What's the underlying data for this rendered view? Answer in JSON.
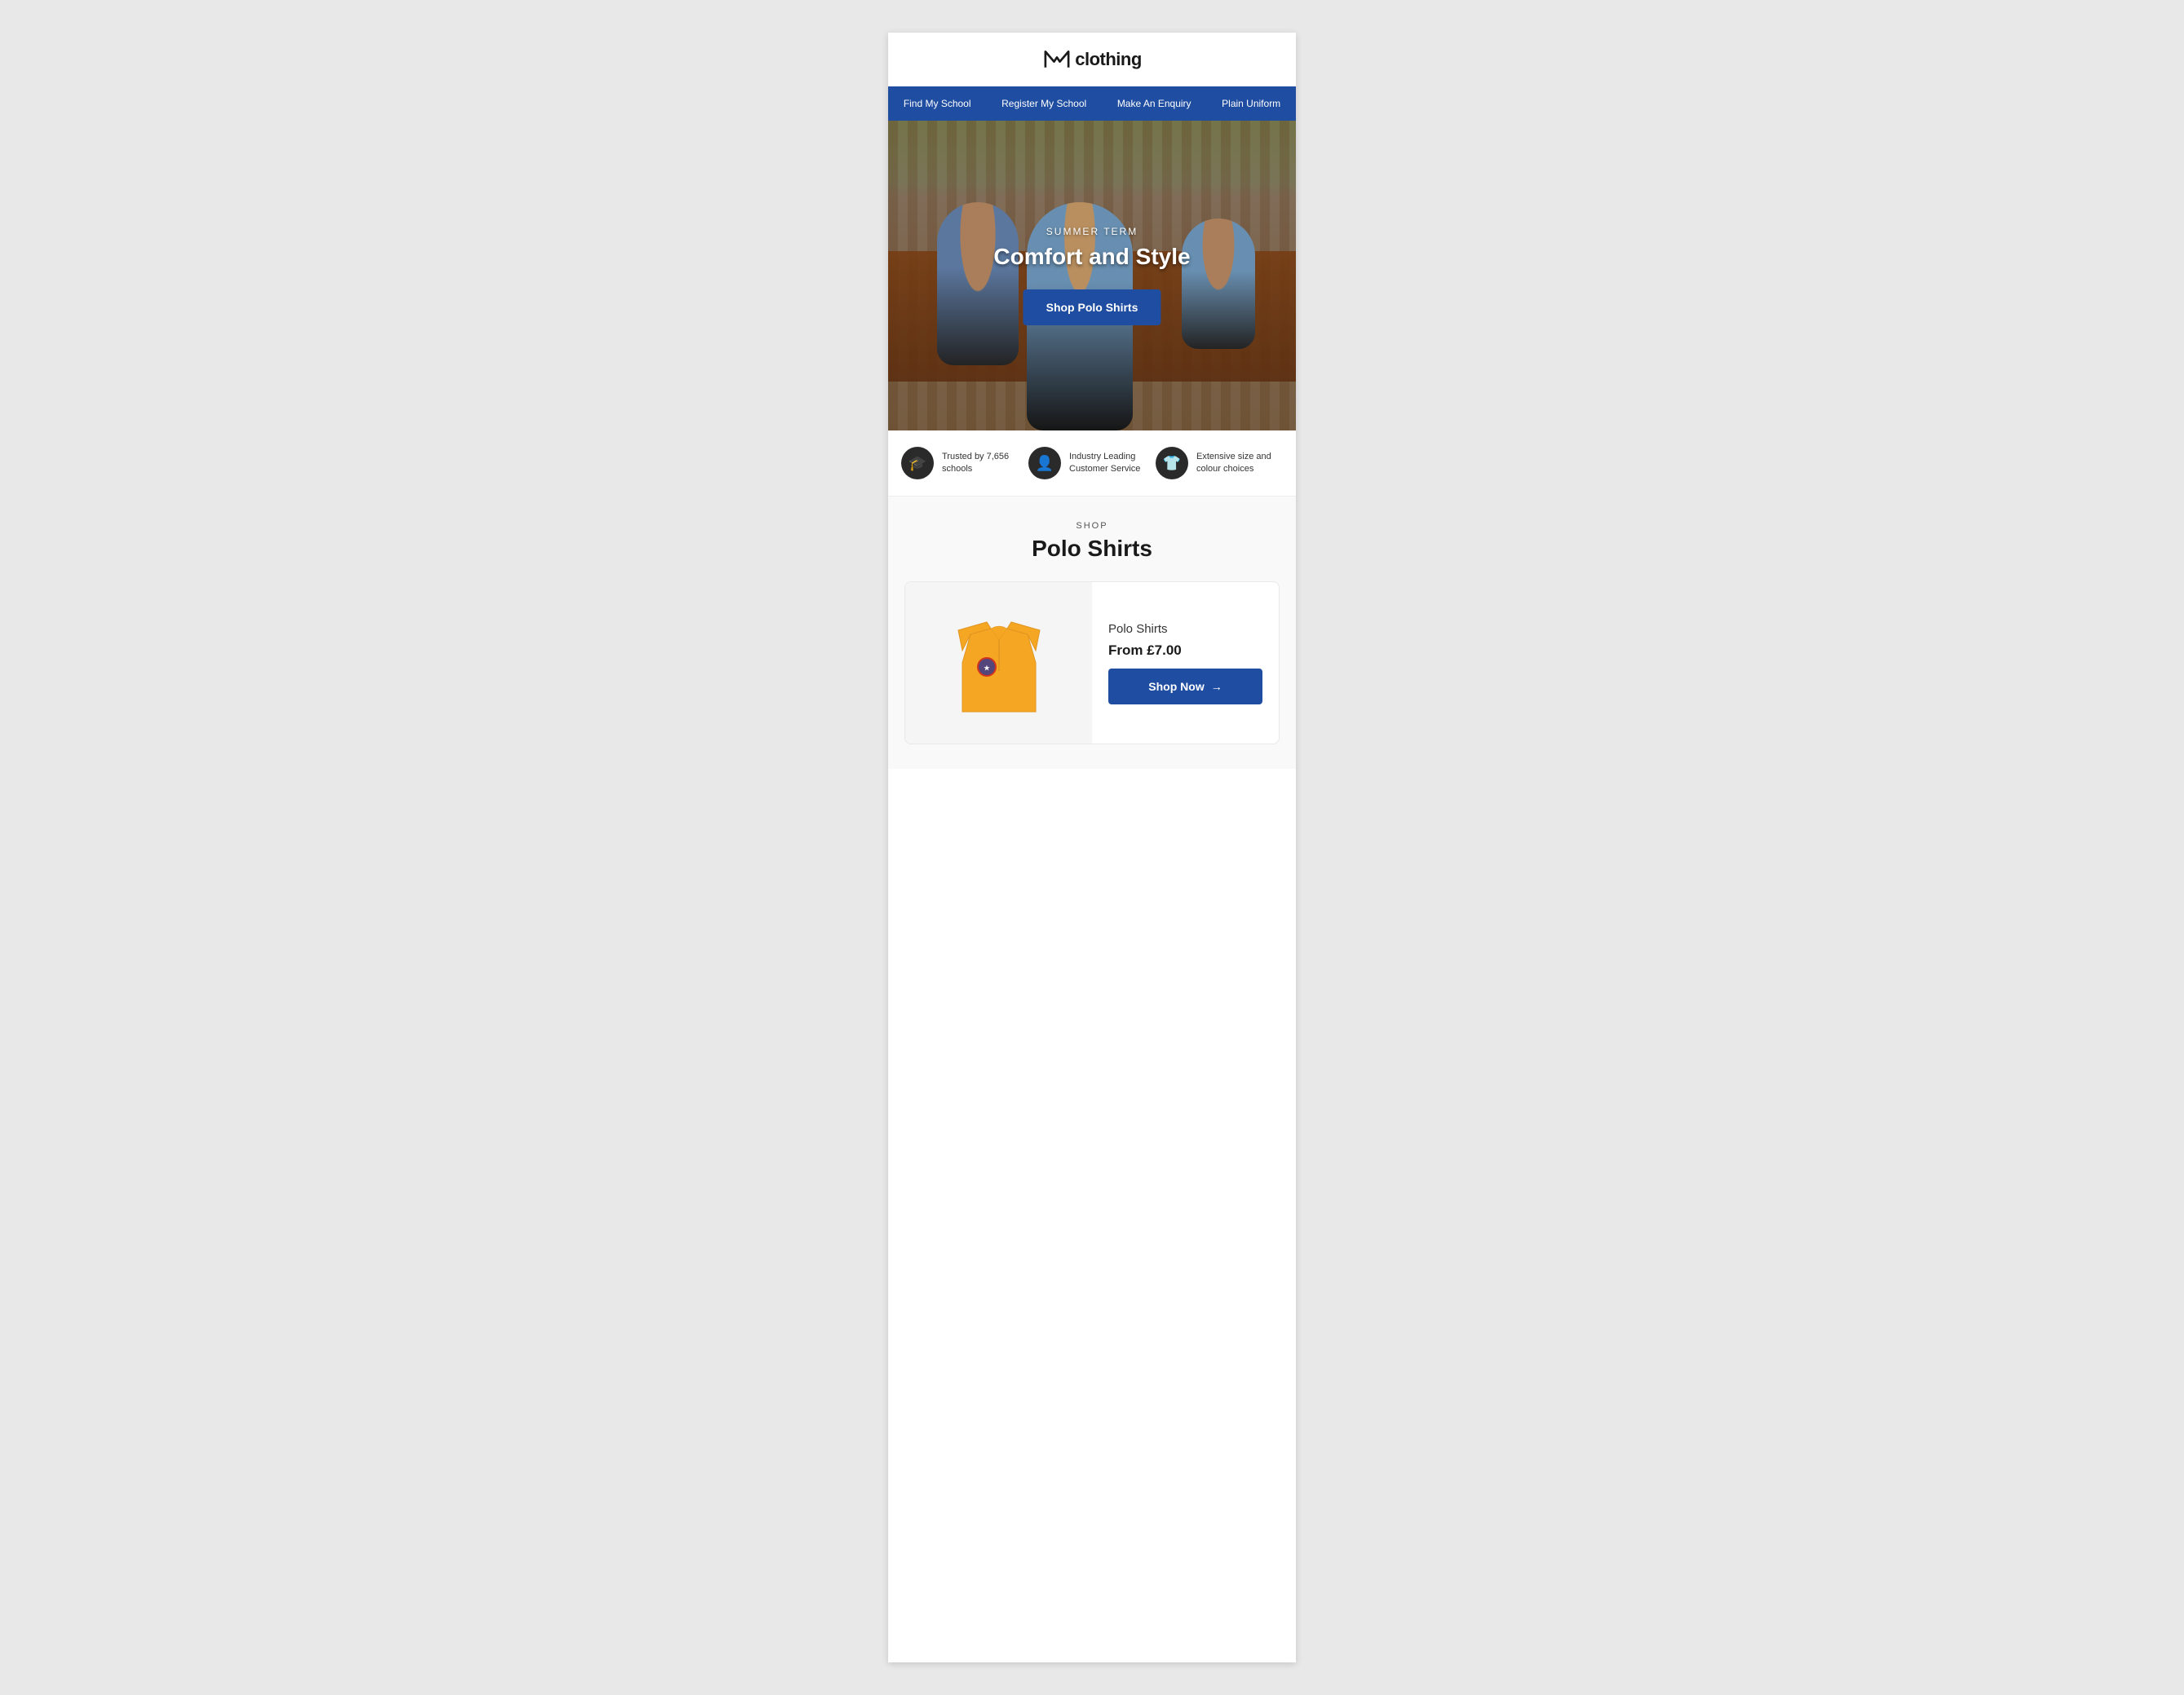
{
  "header": {
    "logo_text": "clothing",
    "logo_prefix": "M"
  },
  "nav": {
    "items": [
      {
        "label": "Find My School",
        "id": "find-my-school"
      },
      {
        "label": "Register My School",
        "id": "register-my-school"
      },
      {
        "label": "Make An Enquiry",
        "id": "make-an-enquiry"
      },
      {
        "label": "Plain Uniform",
        "id": "plain-uniform"
      }
    ]
  },
  "hero": {
    "subtitle": "SUMMER TERM",
    "title": "Comfort and Style",
    "cta_label": "Shop Polo Shirts"
  },
  "trust_bar": {
    "items": [
      {
        "icon": "🎓",
        "text": "Trusted by 7,656 schools",
        "id": "trusted-schools"
      },
      {
        "icon": "👤",
        "text": "Industry Leading Customer Service",
        "id": "customer-service"
      },
      {
        "icon": "👕",
        "text": "Extensive size and colour choices",
        "id": "size-colour"
      }
    ]
  },
  "shop_section": {
    "label": "SHOP",
    "title": "Polo Shirts",
    "product": {
      "name": "Polo Shirts",
      "price": "From £7.00",
      "cta_label": "Shop Now",
      "cta_arrow": "→"
    }
  }
}
